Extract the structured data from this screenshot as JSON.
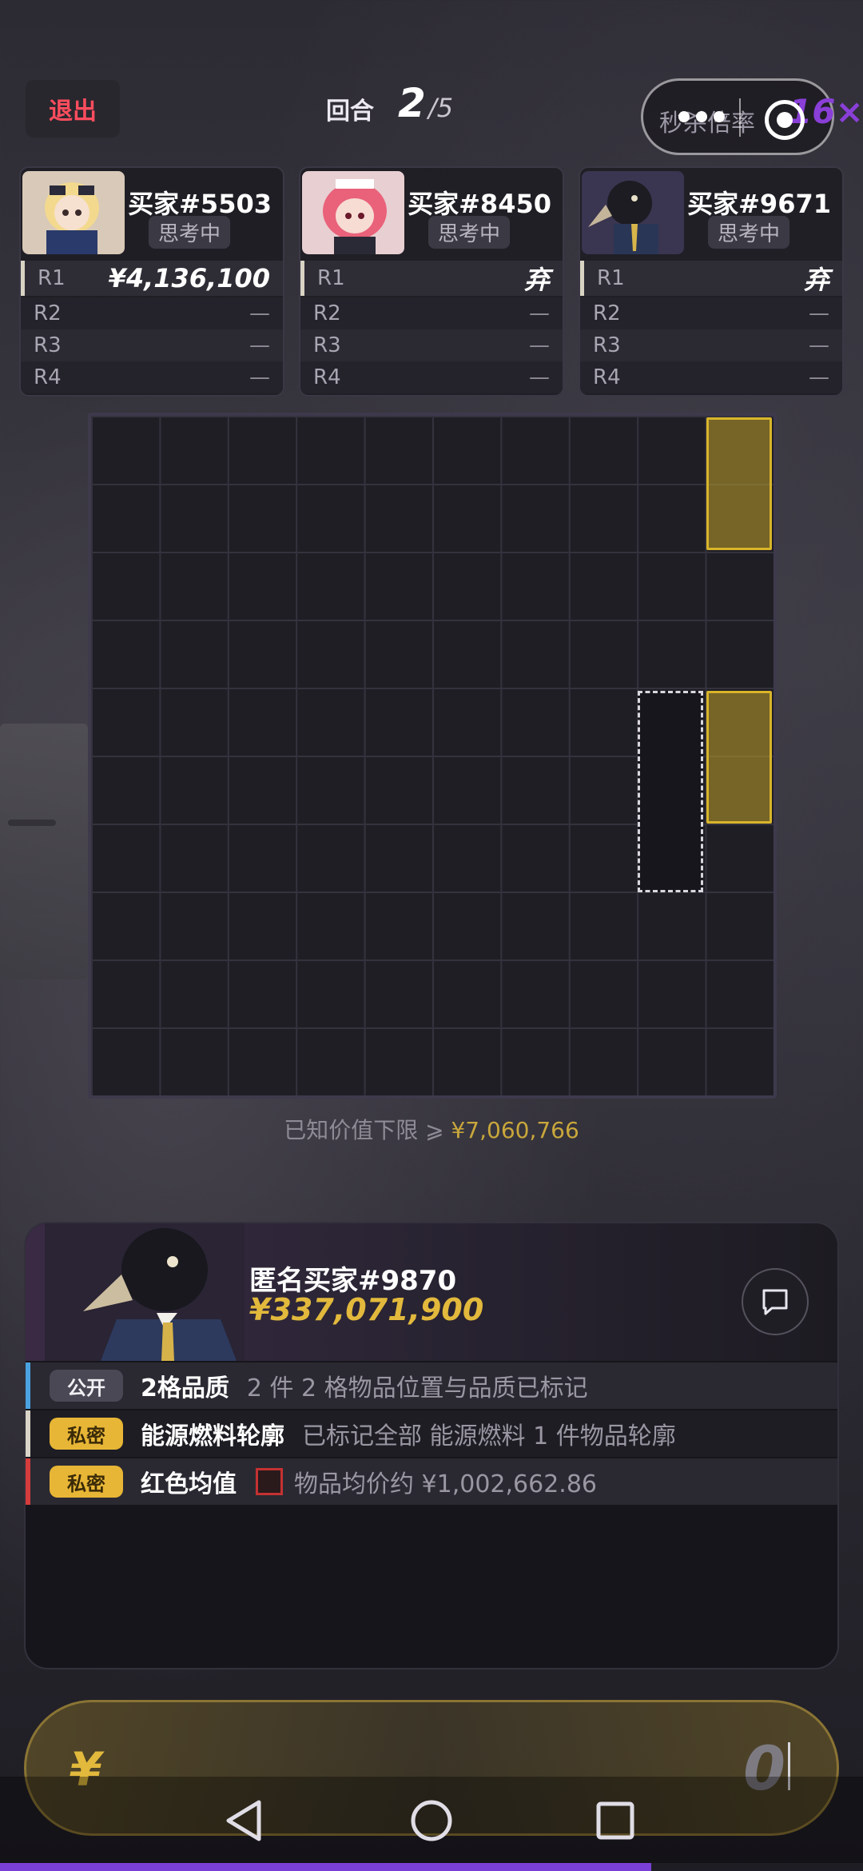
{
  "topbar": {
    "exit_label": "退出",
    "round_label": "回合",
    "round_current": "2",
    "round_total": "/5",
    "kill_rate_label": "秒杀倍率",
    "kill_rate_value": "16×"
  },
  "bidders": [
    {
      "name": "买家#5503",
      "status": "思考中",
      "rows": [
        {
          "round": "R1",
          "value": "¥4,136,100"
        },
        {
          "round": "R2",
          "value": "—"
        },
        {
          "round": "R3",
          "value": "—"
        },
        {
          "round": "R4",
          "value": "—"
        }
      ]
    },
    {
      "name": "买家#8450",
      "status": "思考中",
      "rows": [
        {
          "round": "R1",
          "value": "弃"
        },
        {
          "round": "R2",
          "value": "—"
        },
        {
          "round": "R3",
          "value": "—"
        },
        {
          "round": "R4",
          "value": "—"
        }
      ]
    },
    {
      "name": "买家#9671",
      "status": "思考中",
      "rows": [
        {
          "round": "R1",
          "value": "弃"
        },
        {
          "round": "R2",
          "value": "—"
        },
        {
          "round": "R3",
          "value": "—"
        },
        {
          "round": "R4",
          "value": "—"
        }
      ]
    }
  ],
  "grid": {
    "cols": 10,
    "rows": 10,
    "known_value_prefix": "已知价值下限 ⩾",
    "known_value_amount": "¥7,060,766",
    "item_color": "#d8b52a"
  },
  "player": {
    "name": "匿名买家#9870",
    "amount": "¥337,071,900",
    "info_rows": [
      {
        "badge": "公开",
        "title": "2格品质",
        "desc": "2 件 2 格物品位置与品质已标记",
        "accent": "#4aa3e0"
      },
      {
        "badge": "私密",
        "title": "能源燃料轮廓",
        "desc": "已标记全部 能源燃料 1 件物品轮廓",
        "accent": "#d8d4c8"
      },
      {
        "badge": "私密",
        "title": "红色均值",
        "desc": "物品均价约 ¥1,002,662.86",
        "accent": "#d53c3c"
      }
    ]
  },
  "bid_input": {
    "currency": "¥",
    "value": "0"
  },
  "colors": {
    "accent_gold": "#e2b93c",
    "exit_red": "#ff4d5e",
    "kill_purple": "#8a3fd8"
  }
}
